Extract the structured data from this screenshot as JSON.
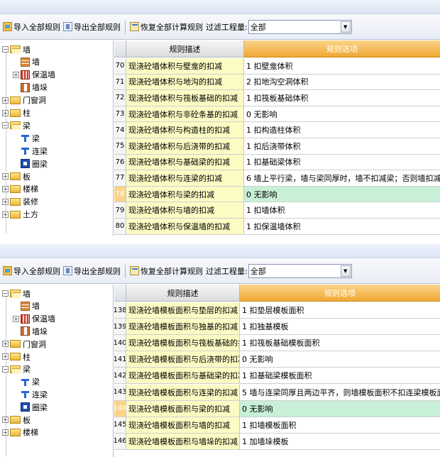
{
  "panels": [
    {
      "toolbar": {
        "import_label": "导入全部规则",
        "export_label": "导出全部规则",
        "restore_label": "恢复全部计算规则",
        "filter_label": "过滤工程量:",
        "filter_value": "全部"
      },
      "tree": [
        {
          "label": "墙",
          "depth": 0,
          "expander": "−",
          "icon": "folder-open"
        },
        {
          "label": "墙",
          "depth": 1,
          "expander": "",
          "icon": "wall"
        },
        {
          "label": "保温墙",
          "depth": 1,
          "expander": "+",
          "icon": "insulation-wall"
        },
        {
          "label": "墙垛",
          "depth": 1,
          "expander": "",
          "icon": "wall-pier"
        },
        {
          "label": "门窗洞",
          "depth": 0,
          "expander": "+",
          "icon": "folder"
        },
        {
          "label": "柱",
          "depth": 0,
          "expander": "+",
          "icon": "folder"
        },
        {
          "label": "梁",
          "depth": 0,
          "expander": "−",
          "icon": "folder-open"
        },
        {
          "label": "梁",
          "depth": 1,
          "expander": "",
          "icon": "beam"
        },
        {
          "label": "连梁",
          "depth": 1,
          "expander": "",
          "icon": "beam"
        },
        {
          "label": "圈梁",
          "depth": 1,
          "expander": "",
          "icon": "ring-beam"
        },
        {
          "label": "板",
          "depth": 0,
          "expander": "+",
          "icon": "folder"
        },
        {
          "label": "楼梯",
          "depth": 0,
          "expander": "+",
          "icon": "folder"
        },
        {
          "label": "装修",
          "depth": 0,
          "expander": "+",
          "icon": "folder"
        },
        {
          "label": "土方",
          "depth": 0,
          "expander": "+",
          "icon": "folder"
        }
      ],
      "grid": {
        "header_desc": "规则描述",
        "header_opt": "规则选项",
        "rows": [
          {
            "num": "70",
            "desc": "现浇砼墙体积与壁龛的扣减",
            "opt": "1  扣壁龛体积",
            "selected": false
          },
          {
            "num": "71",
            "desc": "现浇砼墙体积与地沟的扣减",
            "opt": "2  扣地沟空洞体积",
            "selected": false
          },
          {
            "num": "72",
            "desc": "现浇砼墙体积与筏板基础的扣减",
            "opt": "1  扣筏板基础体积",
            "selected": false
          },
          {
            "num": "73",
            "desc": "现浇砼墙体积与非砼条基的扣减",
            "opt": "0  无影响",
            "selected": false
          },
          {
            "num": "74",
            "desc": "现浇砼墙体积与构造柱的扣减",
            "opt": "1  扣构造柱体积",
            "selected": false
          },
          {
            "num": "75",
            "desc": "现浇砼墙体积与后浇带的扣减",
            "opt": "1    扣后浇带体积",
            "selected": false
          },
          {
            "num": "76",
            "desc": "现浇砼墙体积与基础梁的扣减",
            "opt": "1  扣基础梁体积",
            "selected": false
          },
          {
            "num": "77",
            "desc": "现浇砼墙体积与连梁的扣减",
            "opt": "6  墙上平行梁，墙与梁同厚时，墙不扣减梁；否则墙扣减梁墙相交的实体",
            "selected": false
          },
          {
            "num": "78",
            "desc": "现浇砼墙体积与梁的扣减",
            "opt": "0  无影响",
            "selected": true
          },
          {
            "num": "79",
            "desc": "现浇砼墙体积与墙的扣减",
            "opt": "1  扣墙体积",
            "selected": false
          },
          {
            "num": "80",
            "desc": "现浇砼墙体积与保温墙的扣减",
            "opt": "1  扣保温墙体积",
            "selected": false
          }
        ]
      }
    },
    {
      "toolbar": {
        "import_label": "导入全部规则",
        "export_label": "导出全部规则",
        "restore_label": "恢复全部计算规则",
        "filter_label": "过滤工程量:",
        "filter_value": "全部"
      },
      "tree": [
        {
          "label": "墙",
          "depth": 0,
          "expander": "−",
          "icon": "folder-open"
        },
        {
          "label": "墙",
          "depth": 1,
          "expander": "",
          "icon": "wall"
        },
        {
          "label": "保温墙",
          "depth": 1,
          "expander": "+",
          "icon": "insulation-wall"
        },
        {
          "label": "墙垛",
          "depth": 1,
          "expander": "",
          "icon": "wall-pier"
        },
        {
          "label": "门窗洞",
          "depth": 0,
          "expander": "+",
          "icon": "folder"
        },
        {
          "label": "柱",
          "depth": 0,
          "expander": "+",
          "icon": "folder"
        },
        {
          "label": "梁",
          "depth": 0,
          "expander": "−",
          "icon": "folder-open"
        },
        {
          "label": "梁",
          "depth": 1,
          "expander": "",
          "icon": "beam"
        },
        {
          "label": "连梁",
          "depth": 1,
          "expander": "",
          "icon": "beam"
        },
        {
          "label": "圈梁",
          "depth": 1,
          "expander": "",
          "icon": "ring-beam"
        },
        {
          "label": "板",
          "depth": 0,
          "expander": "+",
          "icon": "folder"
        },
        {
          "label": "楼梯",
          "depth": 0,
          "expander": "+",
          "icon": "folder"
        }
      ],
      "grid": {
        "header_desc": "规则描述",
        "header_opt": "规则选项",
        "rows": [
          {
            "num": "138",
            "desc": "现浇砼墙模板面积与垫层的扣减",
            "opt": "1  扣垫层模板面积",
            "selected": false
          },
          {
            "num": "139",
            "desc": "现浇砼墙模板面积与独基的扣减",
            "opt": "1  扣独基模板",
            "selected": false
          },
          {
            "num": "140",
            "desc": "现浇砼墙模板面积与筏板基础的扣减",
            "opt": "1  扣筏板基础模板面积",
            "selected": false
          },
          {
            "num": "141",
            "desc": "现浇砼墙模板面积与后浇带的扣减",
            "opt": "0  无影响",
            "selected": false
          },
          {
            "num": "142",
            "desc": "现浇砼墙模板面积与基础梁的扣减",
            "opt": "1  扣基础梁模板面积",
            "selected": false
          },
          {
            "num": "143",
            "desc": "现浇砼墙模板面积与连梁的扣减",
            "opt": "5  墙与连梁同厚且两边平齐，则墙模板面积不扣连梁模板面积，否则扣减",
            "selected": false
          },
          {
            "num": "144",
            "desc": "现浇砼墙模板面积与梁的扣减",
            "opt": "0  无影响",
            "selected": true
          },
          {
            "num": "145",
            "desc": "现浇砼墙模板面积与墙的扣减",
            "opt": "1  扣墙模板面积",
            "selected": false
          },
          {
            "num": "146",
            "desc": "现浇砼墙模板面积与墙垛的扣减",
            "opt": "1  加墙垛模板",
            "selected": false
          }
        ]
      }
    }
  ],
  "colors": {
    "header_orange": "#f0a833",
    "desc_yellow": "#fbfbc4",
    "selected_green": "#c8f0d6"
  }
}
